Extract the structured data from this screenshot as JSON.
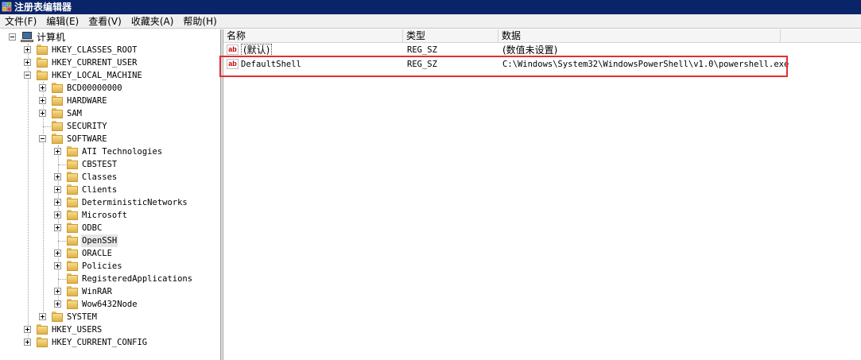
{
  "window": {
    "title": "注册表编辑器"
  },
  "menu": [
    "文件(F)",
    "编辑(E)",
    "查看(V)",
    "收藏夹(A)",
    "帮助(H)"
  ],
  "tree": {
    "root": "计算机",
    "hives": [
      {
        "label": "HKEY_CLASSES_ROOT",
        "expanded": false
      },
      {
        "label": "HKEY_CURRENT_USER",
        "expanded": false
      },
      {
        "label": "HKEY_LOCAL_MACHINE",
        "expanded": true
      },
      {
        "label": "HKEY_USERS",
        "expanded": false
      },
      {
        "label": "HKEY_CURRENT_CONFIG",
        "expanded": false
      }
    ],
    "hklm_children": [
      {
        "label": "BCD00000000",
        "expandable": true
      },
      {
        "label": "HARDWARE",
        "expandable": true
      },
      {
        "label": "SAM",
        "expandable": true
      },
      {
        "label": "SECURITY",
        "expandable": false
      },
      {
        "label": "SOFTWARE",
        "expandable": true,
        "expanded": true
      },
      {
        "label": "SYSTEM",
        "expandable": true
      }
    ],
    "software_children": [
      {
        "label": "ATI Technologies",
        "expandable": true
      },
      {
        "label": "CBSTEST",
        "expandable": false
      },
      {
        "label": "Classes",
        "expandable": true
      },
      {
        "label": "Clients",
        "expandable": true
      },
      {
        "label": "DeterministicNetworks",
        "expandable": true
      },
      {
        "label": "Microsoft",
        "expandable": true
      },
      {
        "label": "ODBC",
        "expandable": true
      },
      {
        "label": "OpenSSH",
        "expandable": false,
        "selected": true
      },
      {
        "label": "ORACLE",
        "expandable": true
      },
      {
        "label": "Policies",
        "expandable": true
      },
      {
        "label": "RegisteredApplications",
        "expandable": false
      },
      {
        "label": "WinRAR",
        "expandable": true
      },
      {
        "label": "Wow6432Node",
        "expandable": true
      }
    ]
  },
  "list": {
    "columns": [
      "名称",
      "类型",
      "数据"
    ],
    "rows": [
      {
        "icon": "string-value-icon",
        "name": "(默认)",
        "type": "REG_SZ",
        "data": "(数值未设置)"
      },
      {
        "icon": "string-value-icon",
        "name": "DefaultShell",
        "type": "REG_SZ",
        "data": "C:\\Windows\\System32\\WindowsPowerShell\\v1.0\\powershell.exe"
      }
    ]
  },
  "icons": {
    "string_value": "ab"
  },
  "colors": {
    "titlebar": "#0a246a",
    "highlight_box": "#e03030",
    "folder": "#f0c850"
  }
}
